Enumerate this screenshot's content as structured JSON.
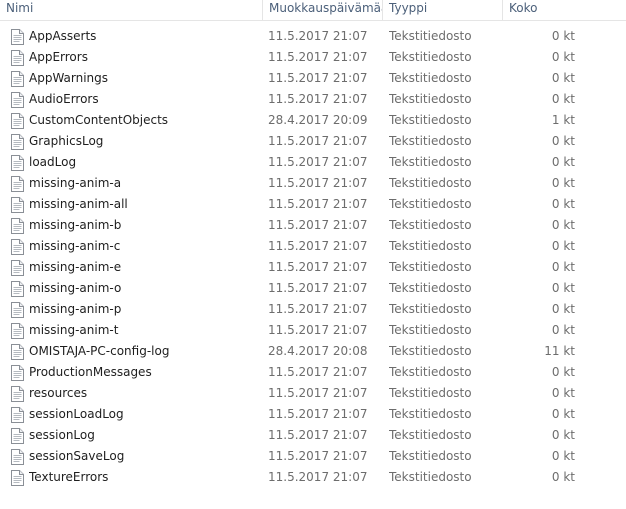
{
  "columns": {
    "name": "Nimi",
    "modified": "Muokkauspäivämäärä",
    "type": "Tyyppi",
    "size": "Koko"
  },
  "file_icon": "text-document-icon",
  "files": [
    {
      "name": "AppAsserts",
      "modified": "11.5.2017 21:07",
      "type": "Tekstitiedosto",
      "size": "0 kt"
    },
    {
      "name": "AppErrors",
      "modified": "11.5.2017 21:07",
      "type": "Tekstitiedosto",
      "size": "0 kt"
    },
    {
      "name": "AppWarnings",
      "modified": "11.5.2017 21:07",
      "type": "Tekstitiedosto",
      "size": "0 kt"
    },
    {
      "name": "AudioErrors",
      "modified": "11.5.2017 21:07",
      "type": "Tekstitiedosto",
      "size": "0 kt"
    },
    {
      "name": "CustomContentObjects",
      "modified": "28.4.2017 20:09",
      "type": "Tekstitiedosto",
      "size": "1 kt"
    },
    {
      "name": "GraphicsLog",
      "modified": "11.5.2017 21:07",
      "type": "Tekstitiedosto",
      "size": "0 kt"
    },
    {
      "name": "loadLog",
      "modified": "11.5.2017 21:07",
      "type": "Tekstitiedosto",
      "size": "0 kt"
    },
    {
      "name": "missing-anim-a",
      "modified": "11.5.2017 21:07",
      "type": "Tekstitiedosto",
      "size": "0 kt"
    },
    {
      "name": "missing-anim-all",
      "modified": "11.5.2017 21:07",
      "type": "Tekstitiedosto",
      "size": "0 kt"
    },
    {
      "name": "missing-anim-b",
      "modified": "11.5.2017 21:07",
      "type": "Tekstitiedosto",
      "size": "0 kt"
    },
    {
      "name": "missing-anim-c",
      "modified": "11.5.2017 21:07",
      "type": "Tekstitiedosto",
      "size": "0 kt"
    },
    {
      "name": "missing-anim-e",
      "modified": "11.5.2017 21:07",
      "type": "Tekstitiedosto",
      "size": "0 kt"
    },
    {
      "name": "missing-anim-o",
      "modified": "11.5.2017 21:07",
      "type": "Tekstitiedosto",
      "size": "0 kt"
    },
    {
      "name": "missing-anim-p",
      "modified": "11.5.2017 21:07",
      "type": "Tekstitiedosto",
      "size": "0 kt"
    },
    {
      "name": "missing-anim-t",
      "modified": "11.5.2017 21:07",
      "type": "Tekstitiedosto",
      "size": "0 kt"
    },
    {
      "name": "OMISTAJA-PC-config-log",
      "modified": "28.4.2017 20:08",
      "type": "Tekstitiedosto",
      "size": "11 kt"
    },
    {
      "name": "ProductionMessages",
      "modified": "11.5.2017 21:07",
      "type": "Tekstitiedosto",
      "size": "0 kt"
    },
    {
      "name": "resources",
      "modified": "11.5.2017 21:07",
      "type": "Tekstitiedosto",
      "size": "0 kt"
    },
    {
      "name": "sessionLoadLog",
      "modified": "11.5.2017 21:07",
      "type": "Tekstitiedosto",
      "size": "0 kt"
    },
    {
      "name": "sessionLog",
      "modified": "11.5.2017 21:07",
      "type": "Tekstitiedosto",
      "size": "0 kt"
    },
    {
      "name": "sessionSaveLog",
      "modified": "11.5.2017 21:07",
      "type": "Tekstitiedosto",
      "size": "0 kt"
    },
    {
      "name": "TextureErrors",
      "modified": "11.5.2017 21:07",
      "type": "Tekstitiedosto",
      "size": "0 kt"
    }
  ]
}
